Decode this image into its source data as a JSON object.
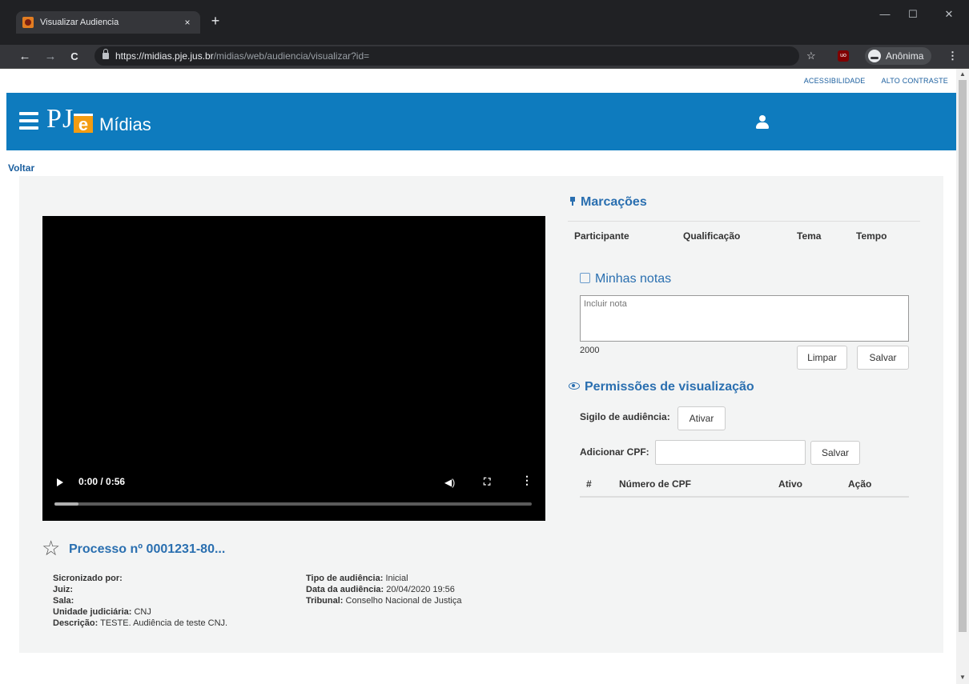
{
  "browser": {
    "tab_title": "Visualizar Audiencia",
    "tab_close": "×",
    "new_tab": "+",
    "url_host": "https://midias.pje.jus.br",
    "url_path": "/midias/web/audiencia/visualizar?id=",
    "incognito_label": "Anônima",
    "extension_label": "uo",
    "win_min": "—",
    "win_max": "☐",
    "win_close": "✕",
    "back": "←",
    "forward": "→",
    "reload": "C",
    "star": "☆",
    "menu": "⋮"
  },
  "accessibility": {
    "acessibilidade": "ACESSIBILIDADE",
    "alto_contraste": "ALTO CONTRASTE"
  },
  "header": {
    "logo_p": "P",
    "logo_j": "J",
    "logo_e": "e",
    "app_name": "Mídias"
  },
  "back_link": "Voltar",
  "video": {
    "time": "0:00 / 0:56",
    "volume_icon": "◀)",
    "fullscreen_icon": "⛶",
    "more_icon": "⋮",
    "progress_fraction": 0.05
  },
  "process": {
    "title": "Processo nº 0001231-80...",
    "left": [
      {
        "label": "Sicronizado por:",
        "value": ""
      },
      {
        "label": "Juiz:",
        "value": ""
      },
      {
        "label": "Sala:",
        "value": ""
      },
      {
        "label": "Unidade judiciária:",
        "value": "CNJ"
      },
      {
        "label": "Descrição:",
        "value": "TESTE. Audiência de teste CNJ."
      }
    ],
    "right": [
      {
        "label": "Tipo de audiência:",
        "value": "Inicial"
      },
      {
        "label": "Data da audiência:",
        "value": "20/04/2020 19:56"
      },
      {
        "label": "Tribunal:",
        "value": "Conselho Nacional de Justiça"
      }
    ]
  },
  "marcacoes": {
    "title": "Marcações",
    "columns": [
      "Participante",
      "Qualificação",
      "Tema",
      "Tempo"
    ]
  },
  "notes": {
    "title": "Minhas notas",
    "placeholder": "Incluir nota",
    "count": "2000",
    "clear_label": "Limpar",
    "save_label": "Salvar"
  },
  "permissions": {
    "title": "Permissões de visualização",
    "sigilo_label": "Sigilo de audiência:",
    "ativar_label": "Ativar",
    "cpf_label": "Adicionar CPF:",
    "save_label": "Salvar",
    "columns": [
      "#",
      "Número de CPF",
      "Ativo",
      "Ação"
    ]
  }
}
